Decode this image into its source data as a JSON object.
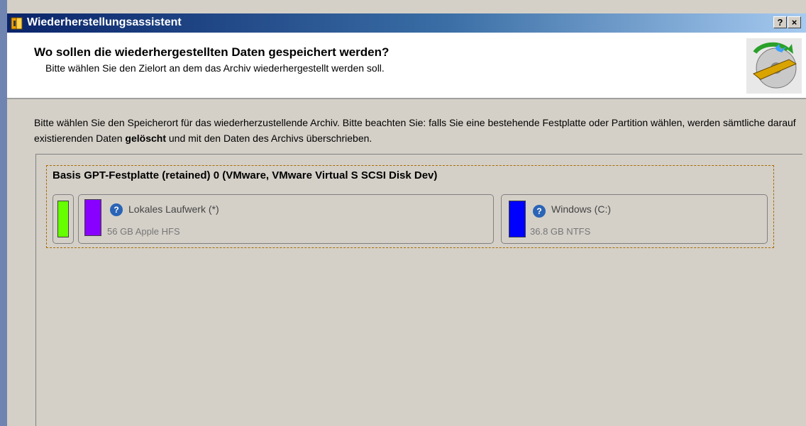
{
  "window": {
    "title": "Wiederherstellungsassistent",
    "help_button": "?",
    "close_button": "×"
  },
  "header": {
    "title": "Wo sollen die wiederhergestellten Daten gespeichert werden?",
    "subtitle": "Bitte wählen Sie den Zielort an dem das Archiv wiederhergestellt werden soll."
  },
  "description": {
    "part1": "Bitte wählen Sie den Speicherort für das wiederherzustellende Archiv. Bitte beachten Sie: falls Sie eine bestehende Festplatte oder Partition wählen, werden sämtliche darauf existierenden Daten ",
    "bold": "gelöscht",
    "part2": " und mit den Daten des Archivs überschrieben."
  },
  "disk": {
    "title": "Basis GPT-Festplatte (retained) 0 (VMware, VMware Virtual S SCSI Disk Dev)",
    "partitions": [
      {
        "name": "",
        "size": "",
        "color": "#66ff00"
      },
      {
        "name": "Lokales Laufwerk (*)",
        "size": "56 GB Apple HFS",
        "color": "#8800ff"
      },
      {
        "name": "Windows (C:)",
        "size": "36.8 GB NTFS",
        "color": "#0000ff"
      }
    ]
  },
  "icons": {
    "app": "restore-app-icon",
    "wizard": "disk-restore-wizard-icon",
    "help": "question-icon"
  }
}
